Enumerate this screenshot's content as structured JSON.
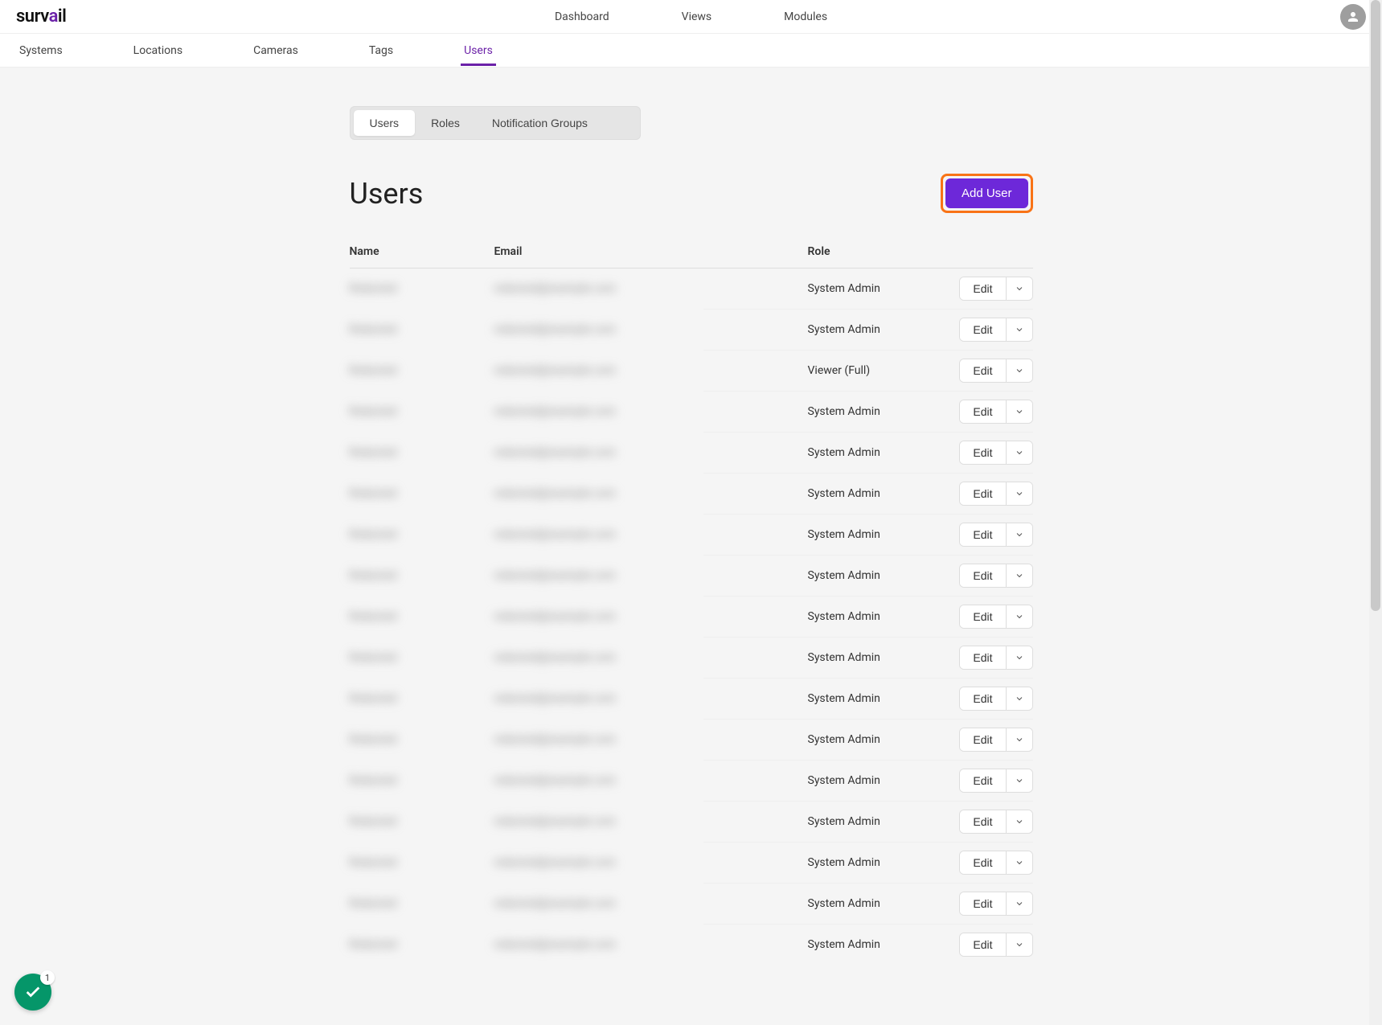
{
  "brand": {
    "pre": "surv",
    "accent": "a",
    "post": "il"
  },
  "topnav": {
    "dashboard": "Dashboard",
    "views": "Views",
    "modules": "Modules"
  },
  "subnav": {
    "systems": "Systems",
    "locations": "Locations",
    "cameras": "Cameras",
    "tags": "Tags",
    "users": "Users"
  },
  "tabs": {
    "users": "Users",
    "roles": "Roles",
    "notification_groups": "Notification Groups"
  },
  "page": {
    "title": "Users",
    "add_user": "Add User"
  },
  "columns": {
    "name": "Name",
    "email": "Email",
    "role": "Role"
  },
  "edit_label": "Edit",
  "status_count": "1",
  "users": [
    {
      "name": "Redacted",
      "email": "redacted@example.com",
      "role": "System Admin"
    },
    {
      "name": "Redacted",
      "email": "redacted@example.com",
      "role": "System Admin"
    },
    {
      "name": "Redacted",
      "email": "redacted@example.com",
      "role": "Viewer (Full)"
    },
    {
      "name": "Redacted",
      "email": "redacted@example.com",
      "role": "System Admin"
    },
    {
      "name": "Redacted",
      "email": "redacted@example.com",
      "role": "System Admin"
    },
    {
      "name": "Redacted",
      "email": "redacted@example.com",
      "role": "System Admin"
    },
    {
      "name": "Redacted",
      "email": "redacted@example.com",
      "role": "System Admin"
    },
    {
      "name": "Redacted",
      "email": "redacted@example.com",
      "role": "System Admin"
    },
    {
      "name": "Redacted",
      "email": "redacted@example.com",
      "role": "System Admin"
    },
    {
      "name": "Redacted",
      "email": "redacted@example.com",
      "role": "System Admin"
    },
    {
      "name": "Redacted",
      "email": "redacted@example.com",
      "role": "System Admin"
    },
    {
      "name": "Redacted",
      "email": "redacted@example.com",
      "role": "System Admin"
    },
    {
      "name": "Redacted",
      "email": "redacted@example.com",
      "role": "System Admin"
    },
    {
      "name": "Redacted",
      "email": "redacted@example.com",
      "role": "System Admin"
    },
    {
      "name": "Redacted",
      "email": "redacted@example.com",
      "role": "System Admin"
    },
    {
      "name": "Redacted",
      "email": "redacted@example.com",
      "role": "System Admin"
    },
    {
      "name": "Redacted",
      "email": "redacted@example.com",
      "role": "System Admin"
    }
  ]
}
